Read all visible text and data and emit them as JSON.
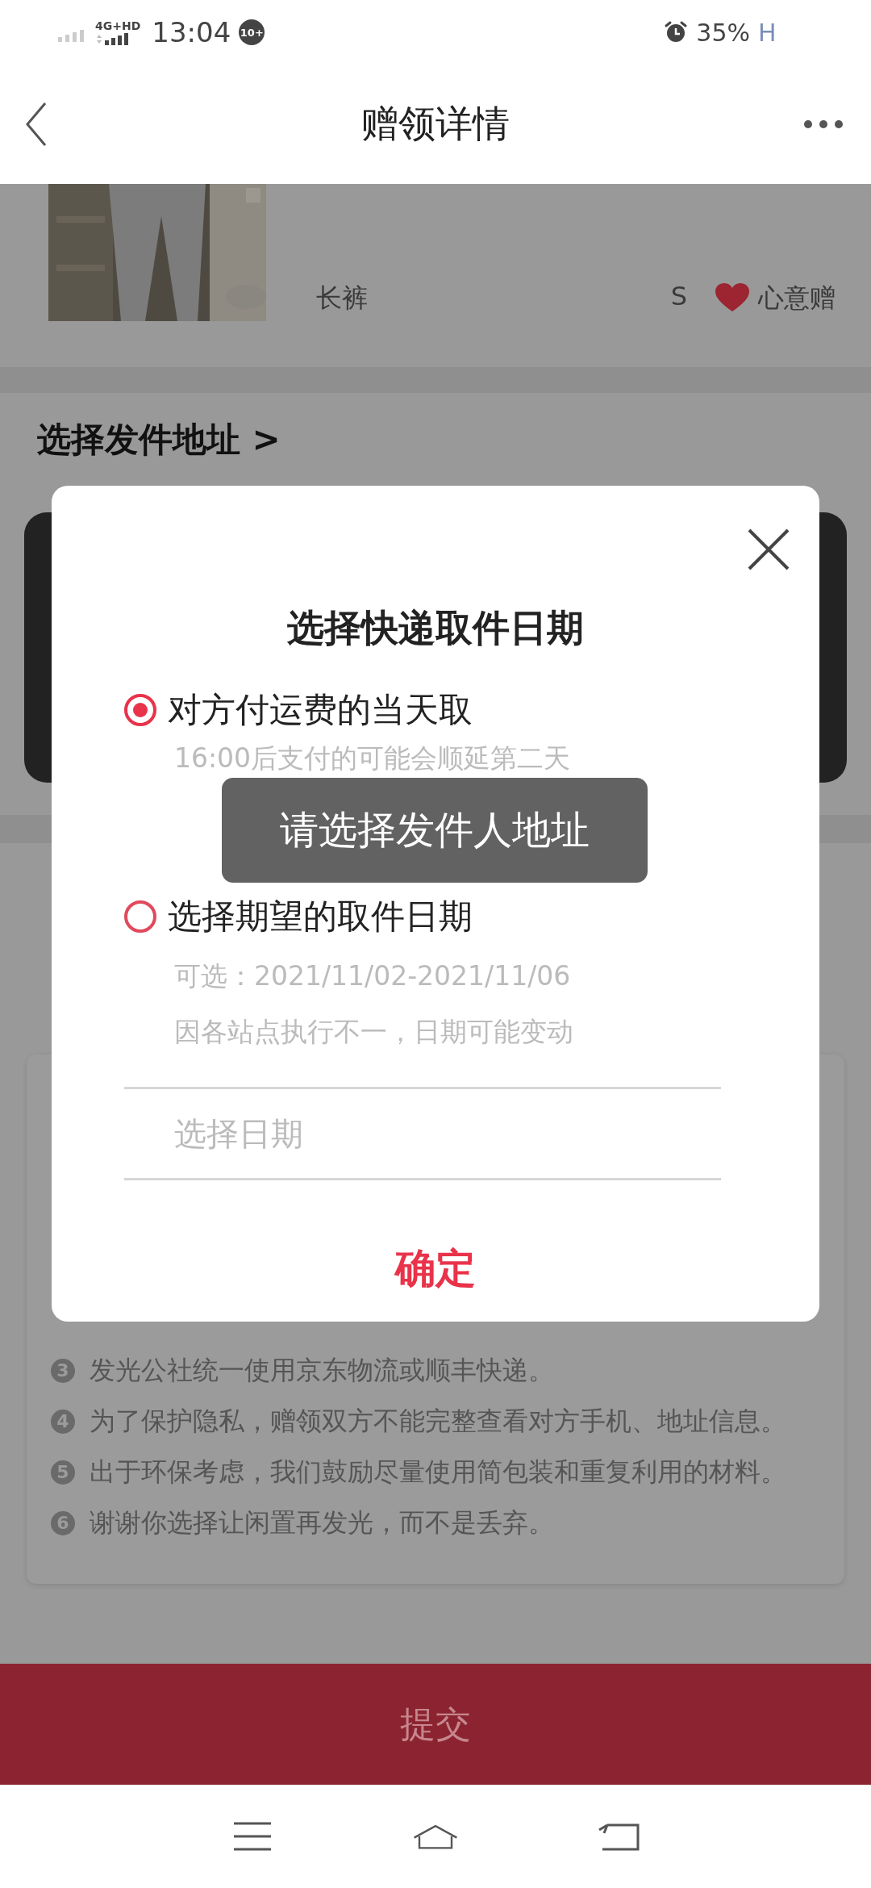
{
  "status_bar": {
    "network": "4G+HD",
    "time": "13:04",
    "badge": "10+",
    "battery": "35%",
    "extra": "H"
  },
  "header": {
    "title": "赠领详情"
  },
  "product": {
    "name": "长裤",
    "size": "S",
    "tag": "心意赠"
  },
  "address": {
    "label": "选择发件地址 >"
  },
  "notes": [
    {
      "number": "3",
      "text": "发光公社统一使用京东物流或顺丰快递。"
    },
    {
      "number": "4",
      "text": "为了保护隐私，赠领双方不能完整查看对方手机、地址信息。"
    },
    {
      "number": "5",
      "text": "出于环保考虑，我们鼓励尽量使用简包装和重复利用的材料。"
    },
    {
      "number": "6",
      "text": "谢谢你选择让闲置再发光，而不是丢弃。"
    }
  ],
  "submit": {
    "label": "提交"
  },
  "dialog": {
    "title": "选择快递取件日期",
    "options": [
      {
        "label": "对方付运费的当天取",
        "hints": [
          "16:00后支付的可能会顺延第二天"
        ],
        "selected": true
      },
      {
        "label": "选择期望的取件日期",
        "hints": [
          "可选：2021/11/02-2021/11/06",
          "因各站点执行不一，日期可能变动"
        ],
        "selected": false
      }
    ],
    "date_field": {
      "placeholder": "选择日期"
    },
    "confirm": "确定"
  },
  "toast": "请选择发件人地址"
}
